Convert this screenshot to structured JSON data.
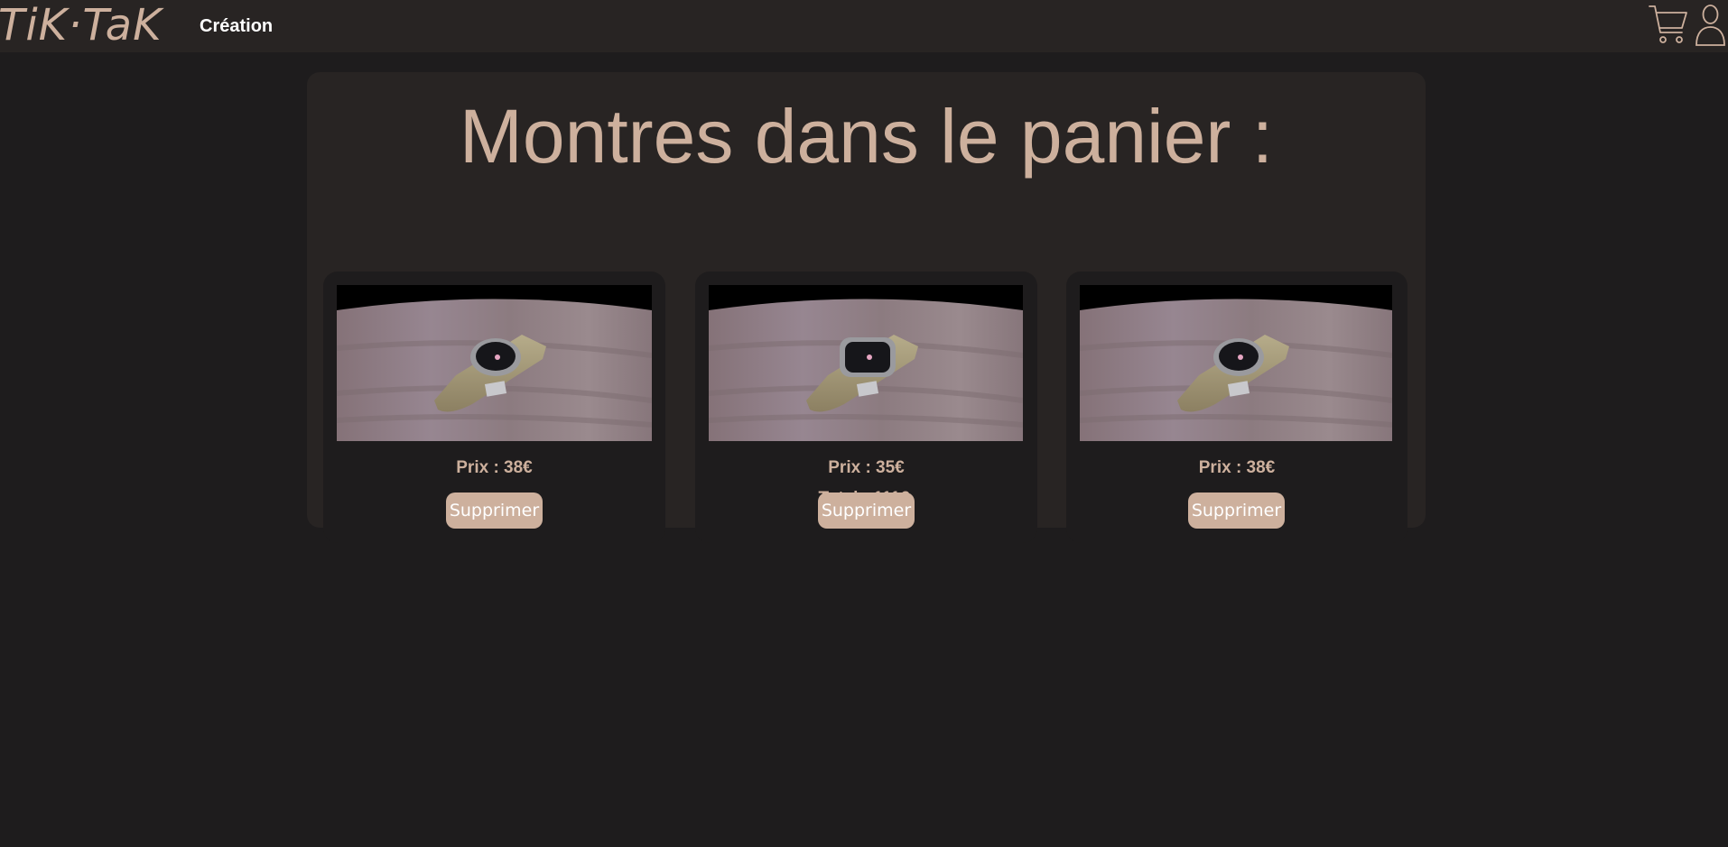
{
  "header": {
    "logo": "TiK·TaK",
    "nav_link": "Création",
    "cart_icon": "cart-icon",
    "user_icon": "user-icon"
  },
  "cart": {
    "title": "Montres dans le panier :",
    "items": [
      {
        "price": "Prix : 38€",
        "remove_label": "Supprimer"
      },
      {
        "price": "Prix : 35€",
        "remove_label": "Supprimer"
      },
      {
        "price": "Prix : 38€",
        "remove_label": "Supprimer"
      }
    ],
    "total": "Total : 111€"
  },
  "colors": {
    "background": "#1e1c1d",
    "navbar": "#282423",
    "accent": "#cdb09d",
    "button_text": "#ffffff"
  }
}
